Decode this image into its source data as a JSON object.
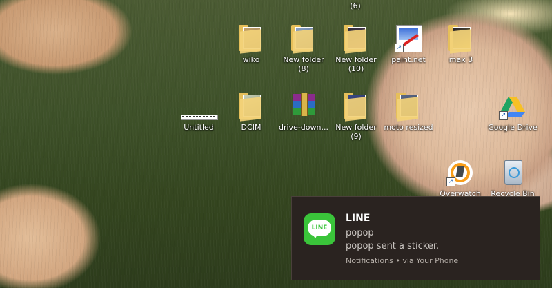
{
  "desktop": {
    "top_partial_label": "(6)",
    "icons": [
      {
        "label": "wiko",
        "icon": "folder-icon"
      },
      {
        "label": "New folder\n(8)",
        "icon": "folder-icon"
      },
      {
        "label": "New folder\n(10)",
        "icon": "folder-icon"
      },
      {
        "label": "paint.net",
        "icon": "paint-net-icon"
      },
      {
        "label": "max 3",
        "icon": "folder-icon"
      },
      {
        "label": "Untitled",
        "icon": "image-file-icon"
      },
      {
        "label": "DCIM",
        "icon": "folder-icon"
      },
      {
        "label": "drive-down...",
        "icon": "winrar-archive-icon"
      },
      {
        "label": "New folder\n(9)",
        "icon": "folder-icon"
      },
      {
        "label": "moto resized",
        "icon": "folder-icon"
      },
      {
        "label": "Google Drive",
        "icon": "google-drive-icon"
      },
      {
        "label": "Overwatch",
        "icon": "overwatch-icon"
      },
      {
        "label": "Recycle Bin",
        "icon": "recycle-bin-icon"
      }
    ]
  },
  "notification": {
    "app_name": "LINE",
    "logo_text": "LINE",
    "sender": "popop",
    "message": "popop sent a sticker.",
    "footer": "Notifications • via Your Phone",
    "accent_color": "#3ac43a"
  }
}
